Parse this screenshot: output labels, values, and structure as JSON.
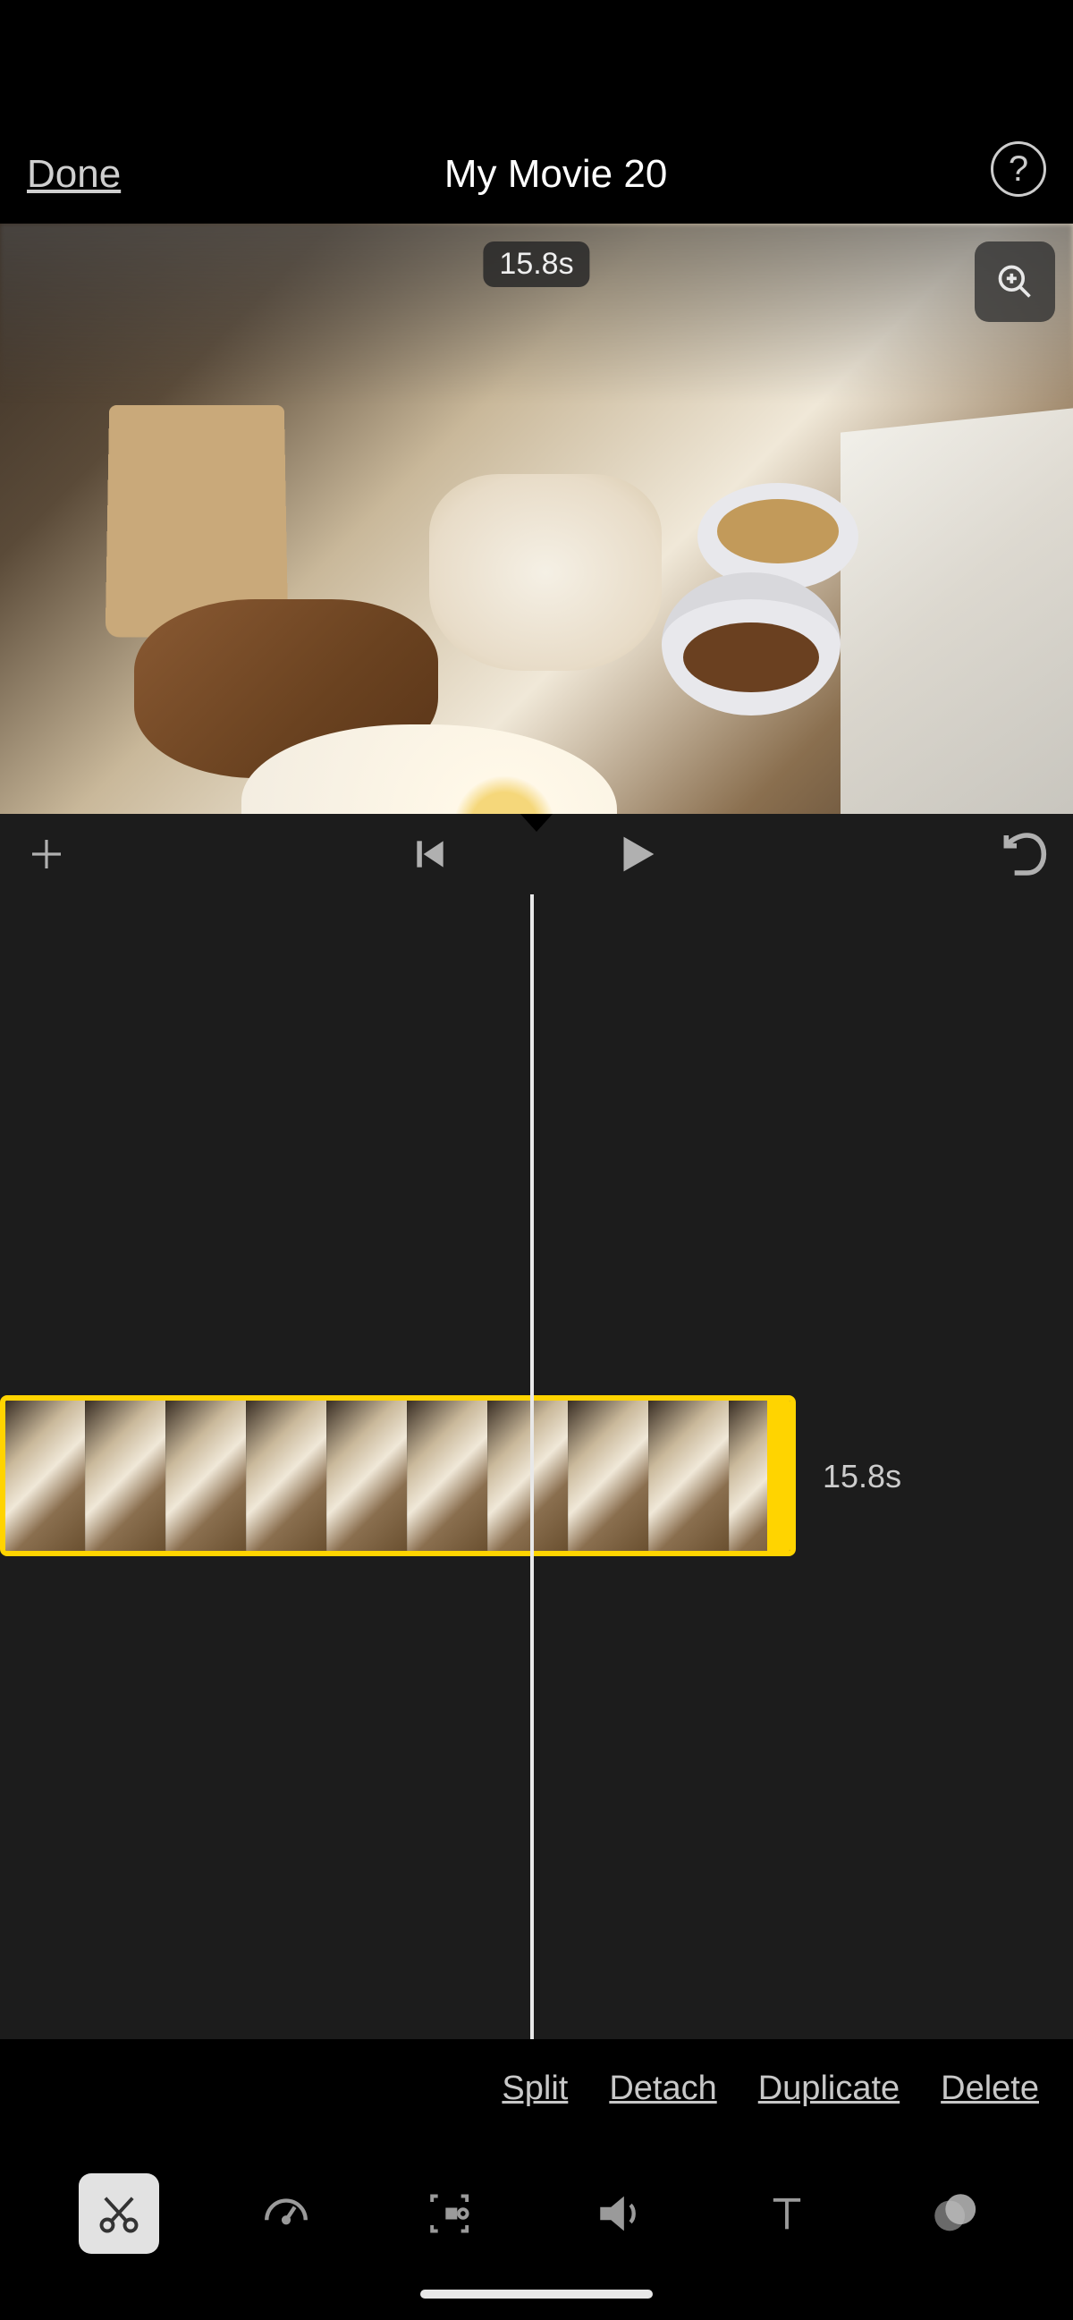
{
  "header": {
    "done_label": "Done",
    "title": "My Movie 20",
    "help_label": "?"
  },
  "preview": {
    "time_label": "15.8s"
  },
  "timeline": {
    "clip_duration_label": "15.8s"
  },
  "actions": {
    "split": "Split",
    "detach": "Detach",
    "duplicate": "Duplicate",
    "delete": "Delete"
  },
  "tools": {
    "active": "trim"
  }
}
